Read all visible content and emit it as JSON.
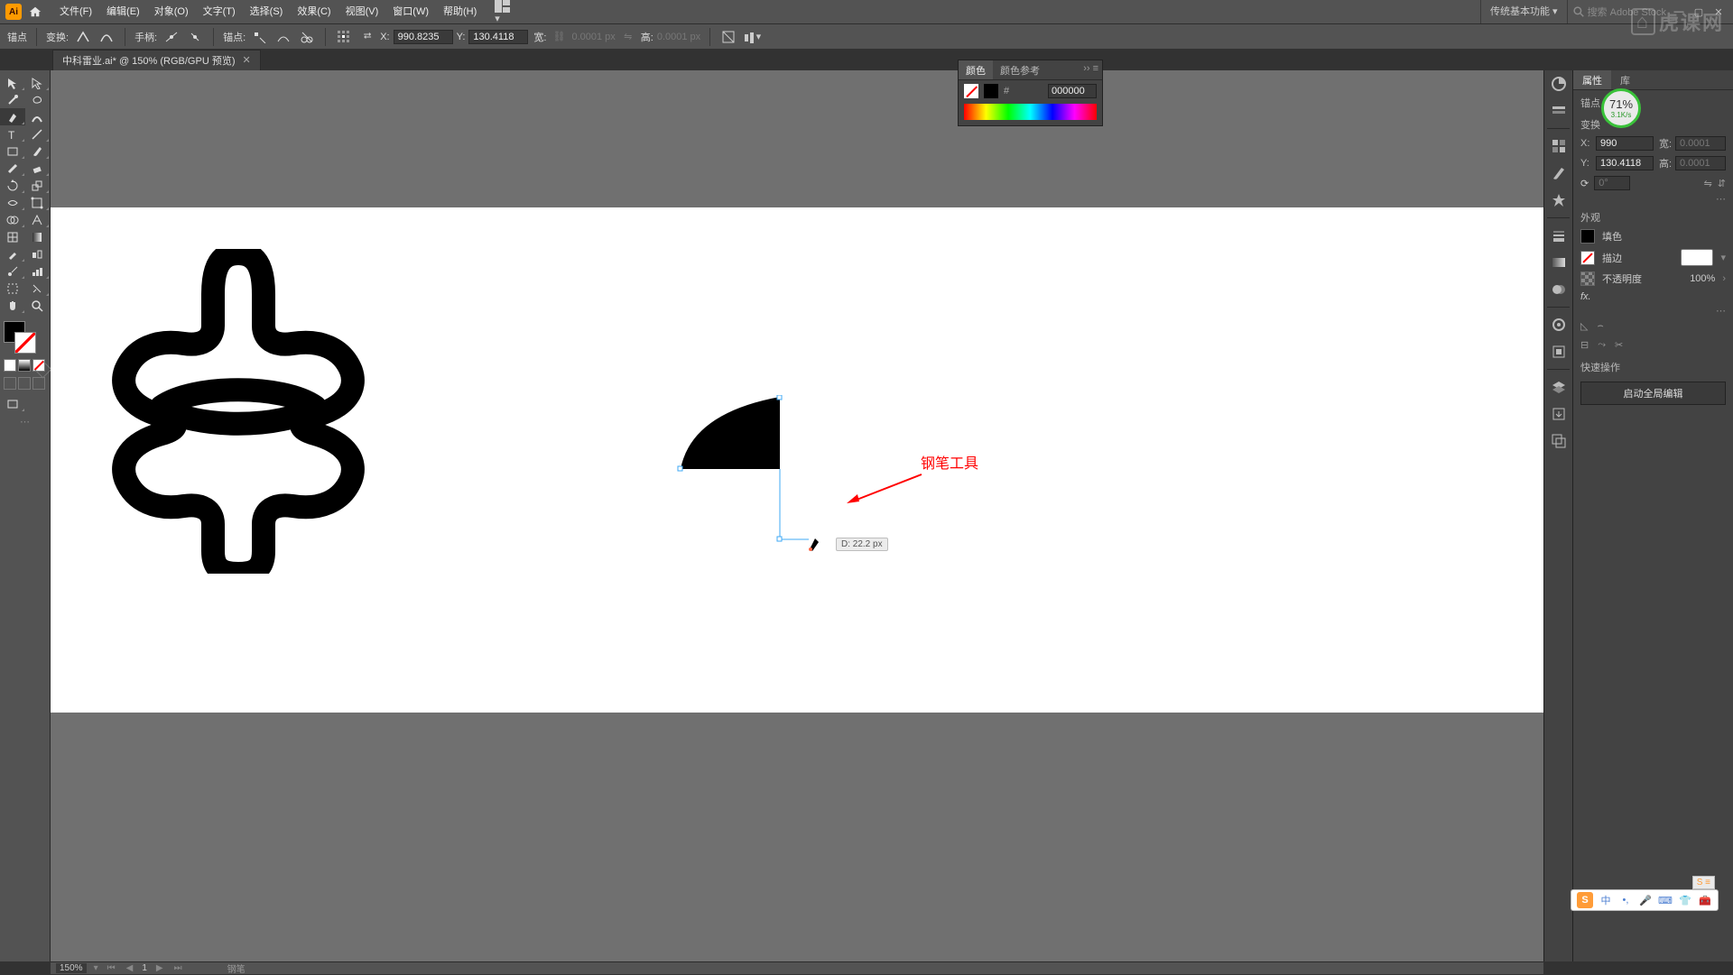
{
  "menubar": {
    "app_abbrev": "Ai",
    "items": [
      "文件(F)",
      "编辑(E)",
      "对象(O)",
      "文字(T)",
      "选择(S)",
      "效果(C)",
      "视图(V)",
      "窗口(W)",
      "帮助(H)"
    ],
    "arrange_icon": "arrange-documents-icon",
    "workspace": "传统基本功能",
    "search_placeholder": "搜索 Adobe Stock"
  },
  "optbar": {
    "left_label": "锚点",
    "convert_label": "变换:",
    "handles_label": "手柄:",
    "anchors_label": "锚点:",
    "x_label": "X:",
    "x_value": "990.8235",
    "y_label": "Y:",
    "y_value": "130.4118",
    "w_label": "宽:",
    "w_value": "0.0001 px",
    "h_label": "高:",
    "h_value": "0.0001 px"
  },
  "tabs": [
    {
      "title": "中科雷业.ai* @ 150% (RGB/GPU 预览)"
    }
  ],
  "color_panel": {
    "tabs": [
      "颜色",
      "颜色参考"
    ],
    "hex_value": "000000"
  },
  "properties": {
    "tabs": [
      "属性",
      "库"
    ],
    "selection_label": "锚点",
    "transform_label": "变换",
    "x_label": "X:",
    "x_value": "990",
    "y_label": "Y:",
    "y_value": "130.4118",
    "w_label": "宽:",
    "w_value": "0.0001",
    "h_label": "高:",
    "h_value": "0.0001",
    "rotate_value": "0°",
    "appearance_label": "外观",
    "fill_label": "填色",
    "stroke_label": "描边",
    "stroke_weight": "",
    "opacity_label": "不透明度",
    "opacity_value": "100%",
    "fx_label": "fx.",
    "quick_label": "快速操作",
    "global_edit_label": "启动全局编辑"
  },
  "canvas": {
    "distance_tag": "D: 22.2 px",
    "red_label": "钢笔工具"
  },
  "statusbar": {
    "zoom": "150%",
    "page": "1",
    "tool": "钢笔"
  },
  "ime": {
    "mode": "中"
  },
  "watermark": "虎课网",
  "badge": {
    "percent": "71%",
    "rate": "3.1K/s"
  },
  "chart_data": null
}
